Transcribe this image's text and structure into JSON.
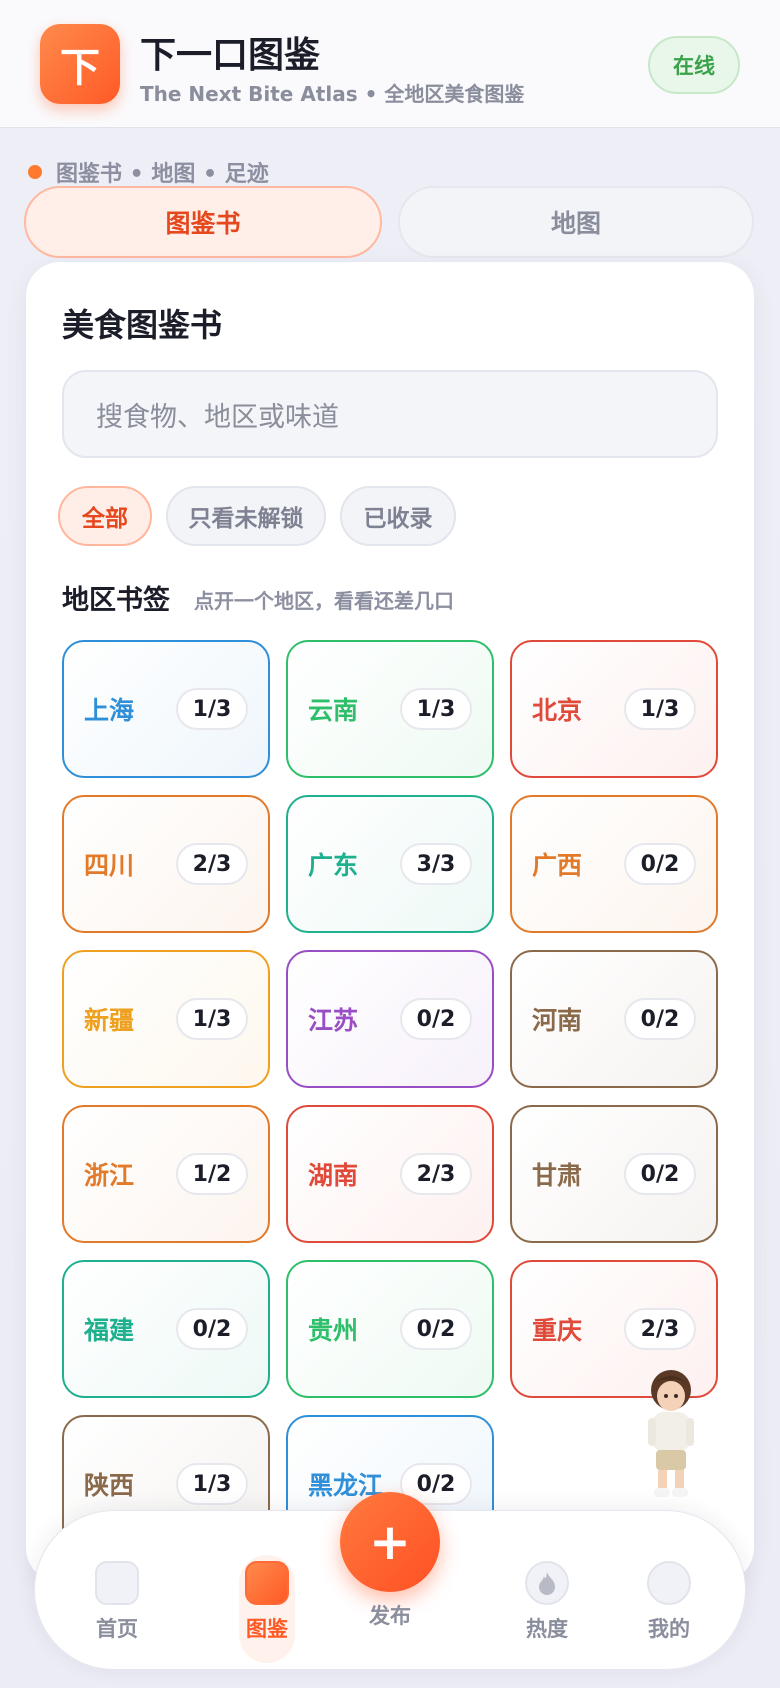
{
  "header": {
    "logo_char": "下",
    "title": "下一口图鉴",
    "subtitle": "The Next Bite Atlas • 全地区美食图鉴",
    "status": "在线"
  },
  "section_label": "图鉴书 • 地图 • 足迹",
  "tabs": [
    {
      "label": "图鉴书",
      "active": true
    },
    {
      "label": "地图",
      "active": false
    }
  ],
  "card": {
    "title": "美食图鉴书",
    "search_placeholder": "搜食物、地区或味道",
    "filters": [
      {
        "label": "全部",
        "active": true
      },
      {
        "label": "只看未解锁",
        "active": false
      },
      {
        "label": "已收录",
        "active": false
      }
    ],
    "region_title": "地区书签",
    "region_hint": "点开一个地区，看看还差几口"
  },
  "regions": [
    {
      "name": "上海",
      "progress": "1/3",
      "color": "#2f8fd8"
    },
    {
      "name": "云南",
      "progress": "1/3",
      "color": "#2fbf6a"
    },
    {
      "name": "北京",
      "progress": "1/3",
      "color": "#e04a3a"
    },
    {
      "name": "四川",
      "progress": "2/3",
      "color": "#e27a2a"
    },
    {
      "name": "广东",
      "progress": "3/3",
      "color": "#1fb08e"
    },
    {
      "name": "广西",
      "progress": "0/2",
      "color": "#e27a2a"
    },
    {
      "name": "新疆",
      "progress": "1/3",
      "color": "#eea020"
    },
    {
      "name": "江苏",
      "progress": "0/2",
      "color": "#9a4ec4"
    },
    {
      "name": "河南",
      "progress": "0/2",
      "color": "#8a6a4a"
    },
    {
      "name": "浙江",
      "progress": "1/2",
      "color": "#e27a2a"
    },
    {
      "name": "湖南",
      "progress": "2/3",
      "color": "#e04a3a"
    },
    {
      "name": "甘肃",
      "progress": "0/2",
      "color": "#8a6a4a"
    },
    {
      "name": "福建",
      "progress": "0/2",
      "color": "#1fb08e"
    },
    {
      "name": "贵州",
      "progress": "0/2",
      "color": "#2fbf6a"
    },
    {
      "name": "重庆",
      "progress": "2/3",
      "color": "#e04a3a"
    },
    {
      "name": "陕西",
      "progress": "1/3",
      "color": "#8a6a4a"
    },
    {
      "name": "黑龙江",
      "progress": "0/2",
      "color": "#2f8fd8"
    }
  ],
  "nav": {
    "items": [
      {
        "label": "首页",
        "icon": "home-icon"
      },
      {
        "label": "图鉴",
        "icon": "atlas-icon",
        "active": true
      },
      {
        "label": "热度",
        "icon": "flame-icon"
      },
      {
        "label": "我的",
        "icon": "profile-icon"
      }
    ],
    "fab_label": "发布",
    "fab_icon": "+"
  }
}
